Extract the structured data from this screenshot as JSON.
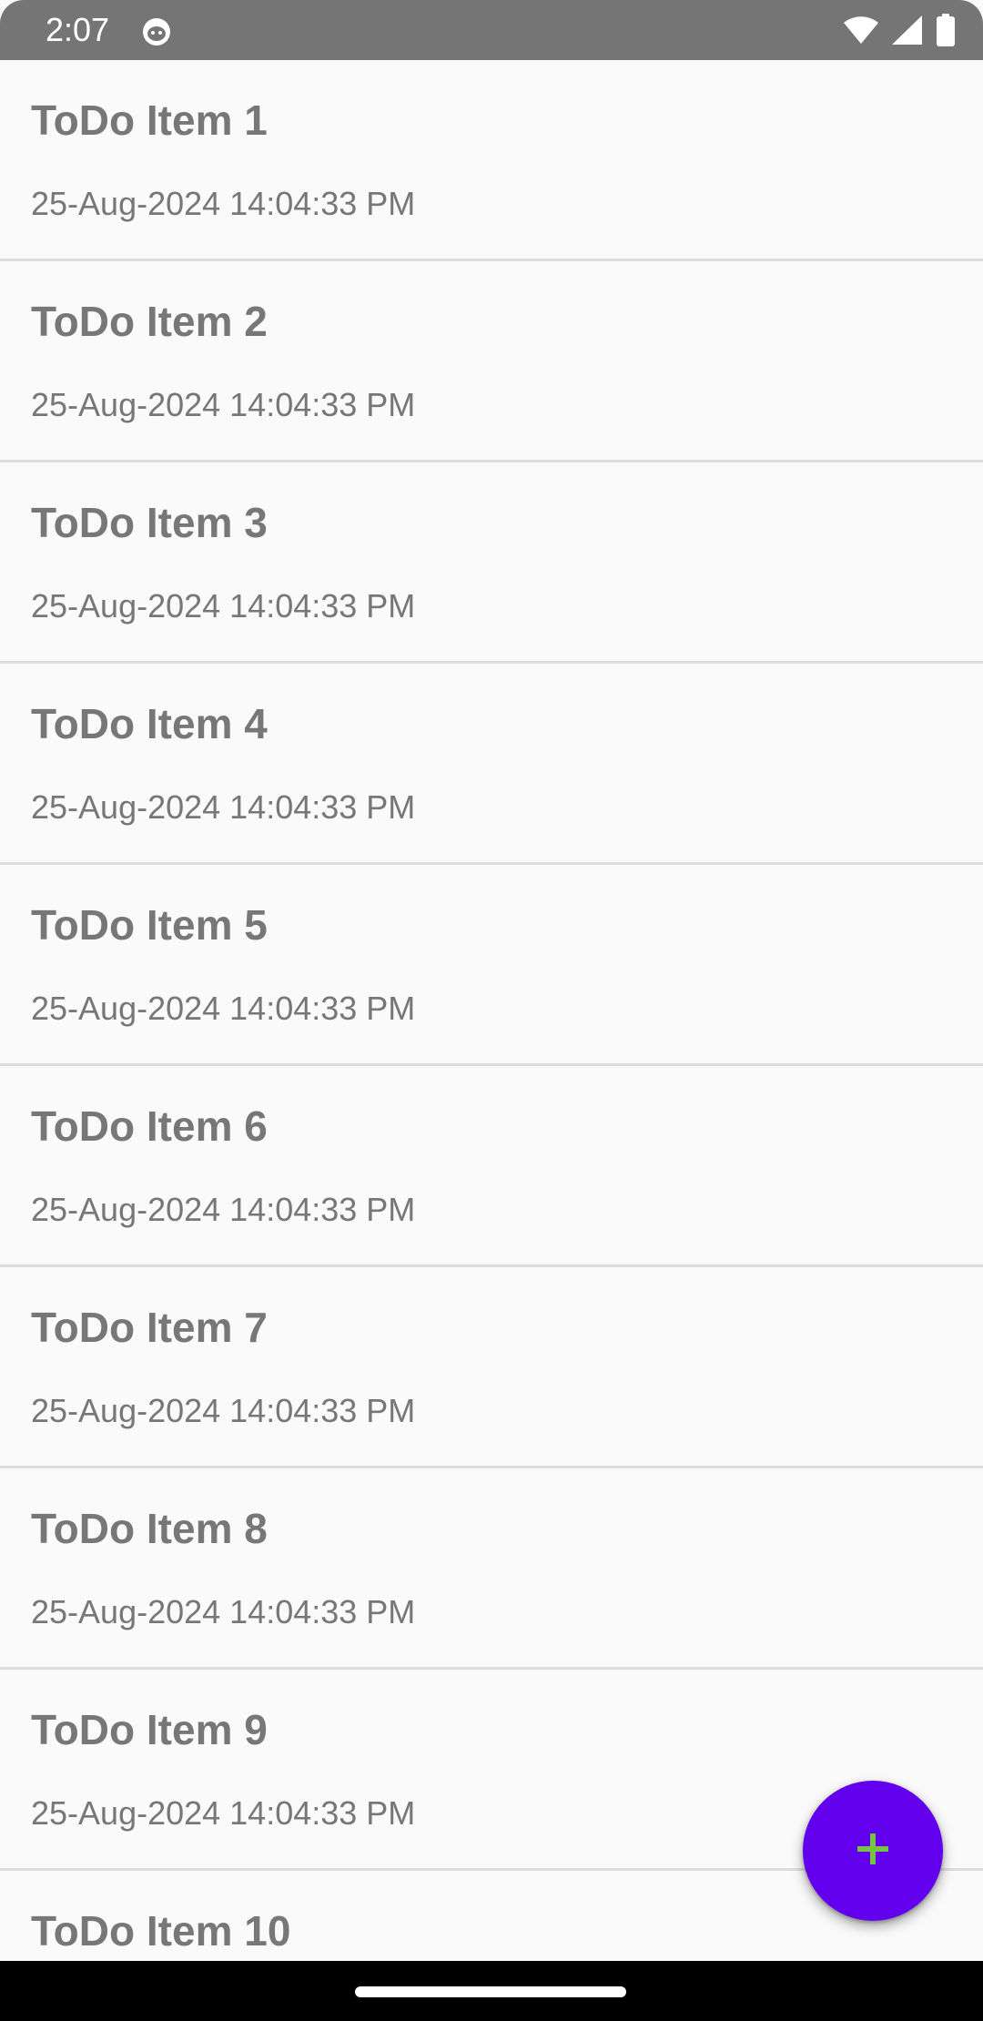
{
  "status_bar": {
    "time": "2:07",
    "icons": [
      "app-notification-icon",
      "wifi-icon",
      "signal-icon",
      "battery-icon"
    ]
  },
  "todo_list": {
    "items": [
      {
        "title": "ToDo Item 1",
        "date": "25-Aug-2024 14:04:33 PM"
      },
      {
        "title": "ToDo Item 2",
        "date": "25-Aug-2024 14:04:33 PM"
      },
      {
        "title": "ToDo Item 3",
        "date": "25-Aug-2024 14:04:33 PM"
      },
      {
        "title": "ToDo Item 4",
        "date": "25-Aug-2024 14:04:33 PM"
      },
      {
        "title": "ToDo Item 5",
        "date": "25-Aug-2024 14:04:33 PM"
      },
      {
        "title": "ToDo Item 6",
        "date": "25-Aug-2024 14:04:33 PM"
      },
      {
        "title": "ToDo Item 7",
        "date": "25-Aug-2024 14:04:33 PM"
      },
      {
        "title": "ToDo Item 8",
        "date": "25-Aug-2024 14:04:33 PM"
      },
      {
        "title": "ToDo Item 9",
        "date": "25-Aug-2024 14:04:33 PM"
      },
      {
        "title": "ToDo Item 10",
        "date": ""
      }
    ]
  },
  "fab": {
    "icon": "plus-icon"
  },
  "colors": {
    "status_bar": "#757575",
    "background": "#fafafa",
    "text": "#777777",
    "divider": "#dddddd",
    "fab_background": "#6200ee",
    "fab_icon": "#76c442",
    "nav_bar": "#000000"
  }
}
